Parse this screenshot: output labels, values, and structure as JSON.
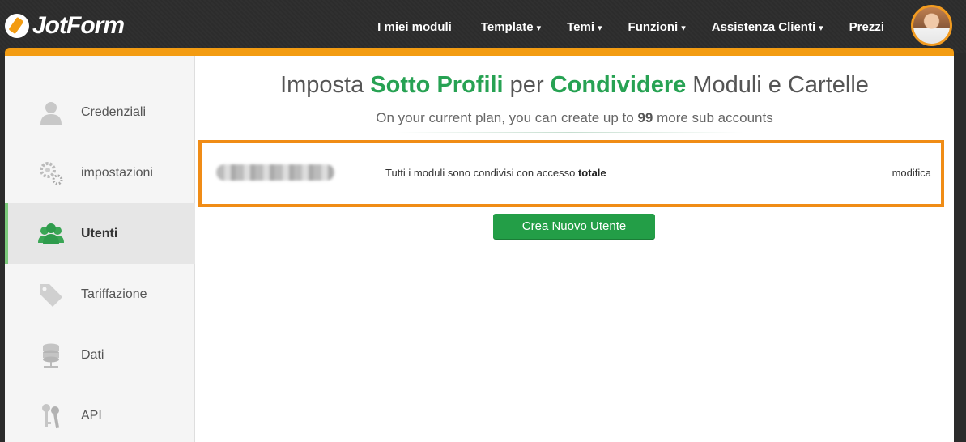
{
  "brand": {
    "name": "JotForm"
  },
  "nav": {
    "items": [
      {
        "label": "I miei moduli",
        "caret": ""
      },
      {
        "label": "Template",
        "caret": "▾"
      },
      {
        "label": "Temi",
        "caret": "▾"
      },
      {
        "label": "Funzioni",
        "caret": "▾"
      },
      {
        "label": "Assistenza Clienti",
        "caret": "▾"
      },
      {
        "label": "Prezzi",
        "caret": ""
      }
    ]
  },
  "colors": {
    "accent_orange": "#f39c12",
    "highlight_green": "#27a253",
    "button_green": "#239e47",
    "active_indicator": "#7bc97b"
  },
  "sidebar": {
    "items": [
      {
        "label": "Credenziali",
        "icon": "user-icon"
      },
      {
        "label": "impostazioni",
        "icon": "gears-icon"
      },
      {
        "label": "Utenti",
        "icon": "users-icon",
        "active": true
      },
      {
        "label": "Tariffazione",
        "icon": "tag-icon"
      },
      {
        "label": "Dati",
        "icon": "database-icon"
      },
      {
        "label": "API",
        "icon": "keys-icon"
      }
    ]
  },
  "main": {
    "heading": {
      "part1": "Imposta ",
      "hl1": "Sotto Profili",
      "part2": " per ",
      "hl2": "Condividere",
      "part3": " Moduli e Cartelle"
    },
    "subheading": {
      "before": "On your current plan, you can create up to ",
      "count": "99",
      "after": " more sub accounts"
    },
    "user_row": {
      "access_text": "Tutti i moduli sono condivisi con accesso ",
      "access_level": "totale",
      "edit_label": "modifica"
    },
    "new_user_button": "Crea Nuovo Utente"
  }
}
